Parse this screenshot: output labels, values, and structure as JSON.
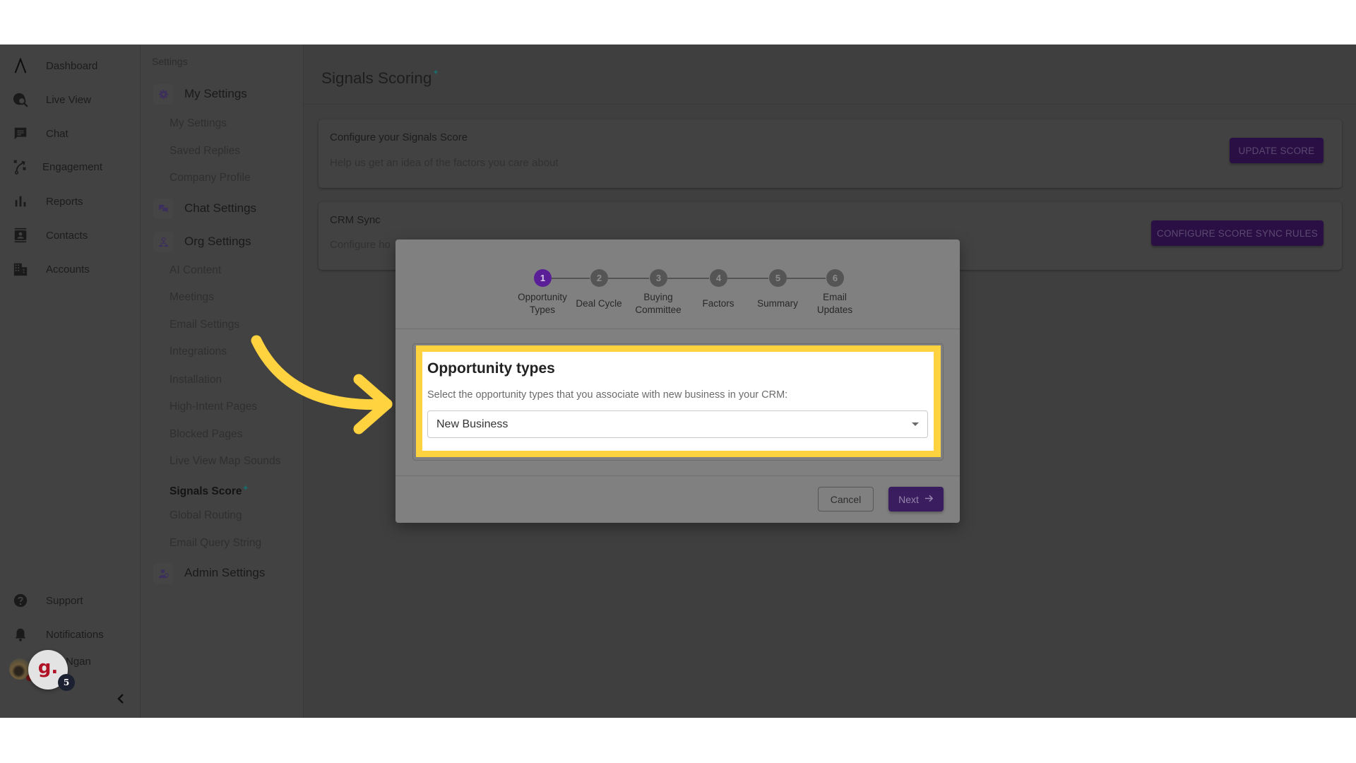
{
  "nav": {
    "items": [
      {
        "label": "Dashboard",
        "icon": "logo-icon"
      },
      {
        "label": "Live View",
        "icon": "globe-search-icon"
      },
      {
        "label": "Chat",
        "icon": "chat-bubble-icon"
      },
      {
        "label": "Engagement",
        "icon": "strategy-icon"
      },
      {
        "label": "Reports",
        "icon": "bar-chart-icon"
      },
      {
        "label": "Contacts",
        "icon": "contact-card-icon"
      },
      {
        "label": "Accounts",
        "icon": "building-icon"
      }
    ],
    "bottom": [
      {
        "label": "Support",
        "icon": "help-circle-icon"
      },
      {
        "label": "Notifications",
        "icon": "bell-icon"
      }
    ],
    "user": {
      "name": "Ngan"
    },
    "help_widget": {
      "glyph": "g.",
      "badge": "5"
    },
    "collapse_icon": "chevron-left-icon"
  },
  "settings_nav": {
    "title": "Settings",
    "groups": [
      {
        "label": "My Settings",
        "icon": "gear-icon",
        "items": [
          "My Settings",
          "Saved Replies",
          "Company Profile"
        ]
      },
      {
        "label": "Chat Settings",
        "icon": "chat-icon",
        "items": []
      },
      {
        "label": "Org Settings",
        "icon": "org-icon",
        "items": [
          "AI Content",
          "Meetings",
          "Email Settings",
          "Integrations",
          "Installation",
          "High-Intent Pages",
          "Blocked Pages",
          "Live View Map Sounds",
          "Signals Score",
          "Global Routing",
          "Email Query String"
        ]
      },
      {
        "label": "Admin Settings",
        "icon": "admin-icon",
        "items": []
      }
    ],
    "active_item": "Signals Score",
    "sparkle": "✦"
  },
  "page": {
    "title": "Signals Scoring",
    "title_sparkle": "✦",
    "cards": [
      {
        "title": "Configure your Signals Score",
        "description": "Help us get an idea of the factors you care about",
        "button": "UPDATE SCORE"
      },
      {
        "title": "CRM Sync",
        "description": "Configure ho",
        "button": "CONFIGURE SCORE SYNC RULES"
      }
    ]
  },
  "modal": {
    "steps": [
      {
        "number": "1",
        "label": "Opportunity Types",
        "active": true
      },
      {
        "number": "2",
        "label": "Deal Cycle",
        "active": false
      },
      {
        "number": "3",
        "label": "Buying Committee",
        "active": false
      },
      {
        "number": "4",
        "label": "Factors",
        "active": false
      },
      {
        "number": "5",
        "label": "Summary",
        "active": false
      },
      {
        "number": "6",
        "label": "Email Updates",
        "active": false
      }
    ],
    "current_step": 1,
    "section_title": "Opportunity types",
    "section_description": "Select the opportunity types that you associate with new business in your CRM:",
    "select": {
      "value": "New Business"
    },
    "cancel_label": "Cancel",
    "next_label": "Next"
  },
  "annotation": {
    "highlight_color": "#FFD23F",
    "arrow_color": "#FFD23F"
  },
  "colors": {
    "brand_purple": "#5A1F96",
    "button_purple": "#3A1D5F",
    "accent_teal": "#1C6A6A"
  }
}
